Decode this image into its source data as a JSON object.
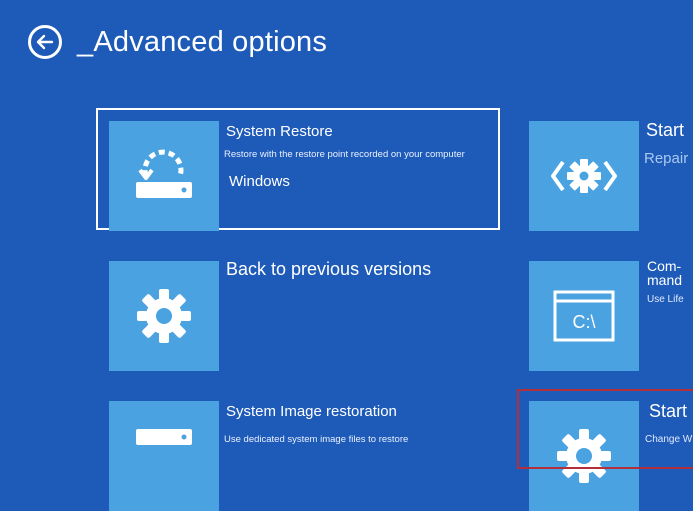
{
  "header": {
    "title": "_Advanced options"
  },
  "tiles": [
    {
      "title": "System Restore",
      "description": "Restore with the restore point recorded on your computer",
      "extra": "Windows"
    },
    {
      "title": "Back to previous versions"
    },
    {
      "title": "System Image restoration",
      "description": "Use dedicated system image files to restore"
    }
  ],
  "right_tiles": [
    {
      "title": "Start",
      "subtitle": "Repair"
    },
    {
      "title_line1": "Com-",
      "title_line2": "mand",
      "subtitle": "Use Life"
    },
    {
      "title": "Start",
      "subtitle": "Change W"
    }
  ],
  "colors": {
    "background": "#1e5bb8",
    "tile": "#4aa3e0",
    "highlight_frame": "#b3303a"
  }
}
